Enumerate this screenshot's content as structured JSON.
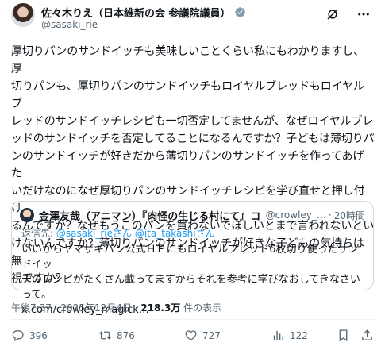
{
  "author": {
    "display_name": "佐々木りえ（日本維新の会 参議院議員）",
    "handle": "@sasaki_rie"
  },
  "post": {
    "text": "厚切りパンのサンドイッチも美味しいことくらい私にもわかりますし、厚\n切りパンも、厚切りパンのサンドイッチもロイヤルブレッドもロイヤルブ\nレッドのサンドイッチレシピも一切否定してませんが、なぜロイヤルブレ\nッドのサンドイッチを否定してることになるんですか？子どもは薄切りパ\nンのサンドイッチが好きだから薄切りパンのサンドイッチを作ってあげた\nいだけなのになぜ厚切りパンのサンドイッチレシピを学び直せと押し付け\nるんですか？なぜもうこのパンを買わないでほしいとまで言われないとい\nけないんですか？薄切りパンのサンドイッチが好きな子どもの気持ちは無\n視ですか？",
    "time": "午後7:37",
    "date": "2025年12月4日",
    "views_count": "218.3万",
    "views_label": "件の表示"
  },
  "quote": {
    "display_name": "金澤友哉（アニマン）『肉怪の生じる村にて』コミ…",
    "handle": "@crowley_…",
    "time": "20時間",
    "reply_prefix": "返信先: ",
    "reply_to_1": "@sasaki_rieさん",
    "reply_to_2": "@ita_takashiさん",
    "text": "いいからヤマザキパン公式ＨＰにもロイヤルブレッド6枚切り使ったサンドイッ\nチのレシピがたくさん載ってますからそれを参考に学びなおしてきなさいって。\nx.com/crowley_magick…"
  },
  "actions": {
    "replies": "396",
    "reposts": "876",
    "likes": "727",
    "views": "122"
  },
  "icons": {
    "verified": "verified-badge-icon",
    "grok": "grok-icon",
    "more": "more-icon",
    "reply": "reply-icon",
    "repost": "repost-icon",
    "like": "like-icon",
    "analytics": "analytics-icon",
    "bookmark": "bookmark-icon",
    "share": "share-icon"
  },
  "colors": {
    "accent": "#1d9bf0",
    "verified": "#829aab",
    "text": "#0f1419",
    "secondary": "#536471"
  }
}
